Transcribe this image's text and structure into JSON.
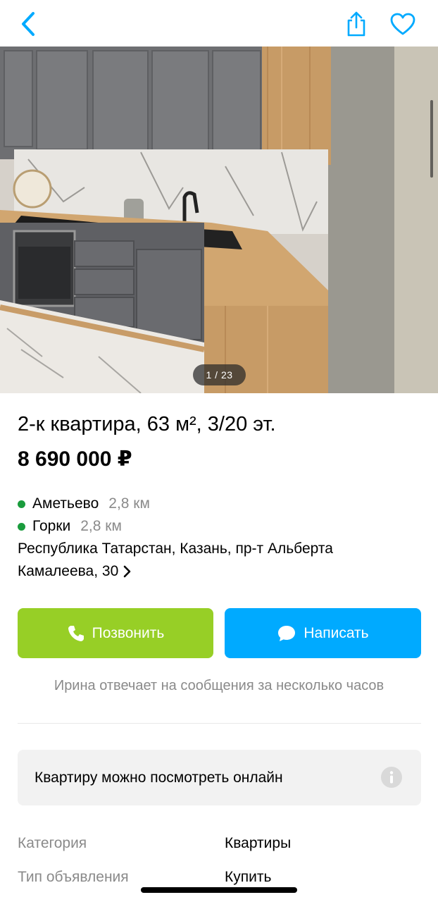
{
  "header": {
    "back_icon": "chevron-left-icon",
    "share_icon": "share-icon",
    "favorite_icon": "heart-icon",
    "accent_color": "#00aaff"
  },
  "gallery": {
    "counter": "1 / 23",
    "image_description_icon": "kitchen-photo"
  },
  "listing": {
    "title": "2-к квартира, 63 м², 3/20 эт.",
    "price": "8 690 000 ₽"
  },
  "location": {
    "metro": [
      {
        "name": "Аметьево",
        "distance": "2,8 км"
      },
      {
        "name": "Горки",
        "distance": "2,8 км"
      }
    ],
    "address_line1": "Республика Татарстан, Казань, пр-т Альберта",
    "address_line2": "Камалеева, 30",
    "metro_color": "#1a9c3d"
  },
  "actions": {
    "call_label": "Позвонить",
    "call_color": "#97cf26",
    "write_label": "Написать",
    "write_color": "#00aaff"
  },
  "reply_note": "Ирина отвечает на сообщения за несколько часов",
  "online_view": {
    "text": "Квартиру можно посмотреть онлайн",
    "icon": "info-icon"
  },
  "params": [
    {
      "label": "Категория",
      "value": "Квартиры"
    },
    {
      "label": "Тип объявления",
      "value": "Купить"
    }
  ]
}
